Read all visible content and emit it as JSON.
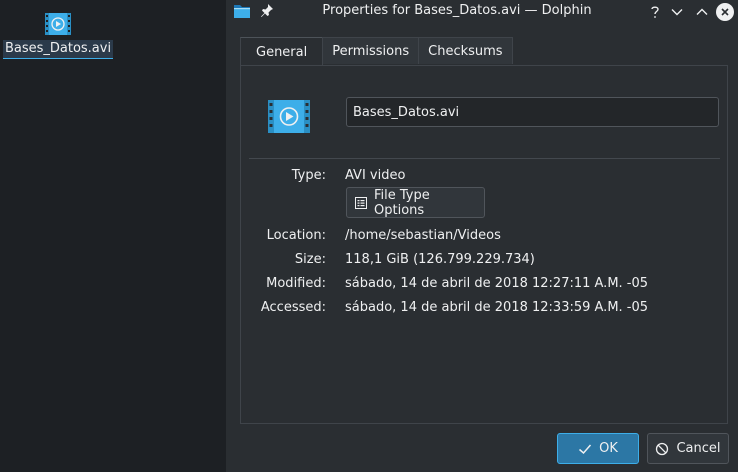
{
  "desktop": {
    "file": {
      "name": "Bases_Datos.avi",
      "icon": "video-file-icon"
    }
  },
  "window": {
    "title": "Properties for Bases_Datos.avi — Dolphin",
    "app_icon": "folder-icon",
    "pin_icon": "pin-icon",
    "controls": {
      "help": "question-mark-icon",
      "minimize": "chevron-down-icon",
      "maximize": "chevron-up-icon",
      "close": "close-icon"
    }
  },
  "tabs": [
    {
      "label": "General",
      "active": true
    },
    {
      "label": "Permissions",
      "active": false
    },
    {
      "label": "Checksums",
      "active": false
    }
  ],
  "general": {
    "file_icon": "video-file-icon",
    "filename": "Bases_Datos.avi",
    "type_label": "Type:",
    "type_value": "AVI video",
    "file_type_options_label": "File Type Options",
    "location_label": "Location:",
    "location_value": "/home/sebastian/Videos",
    "size_label": "Size:",
    "size_value": "118,1 GiB (126.799.229.734)",
    "modified_label": "Modified:",
    "modified_value": "sábado, 14 de abril de 2018 12:27:11 A.M. -05",
    "accessed_label": "Accessed:",
    "accessed_value": "sábado, 14 de abril de 2018 12:33:59 A.M. -05"
  },
  "buttons": {
    "ok_label": "OK",
    "cancel_label": "Cancel"
  },
  "colors": {
    "accent": "#3daee9",
    "window_bg": "#2a2e32",
    "desktop_bg": "#1d2024",
    "text": "#eff0f1"
  }
}
